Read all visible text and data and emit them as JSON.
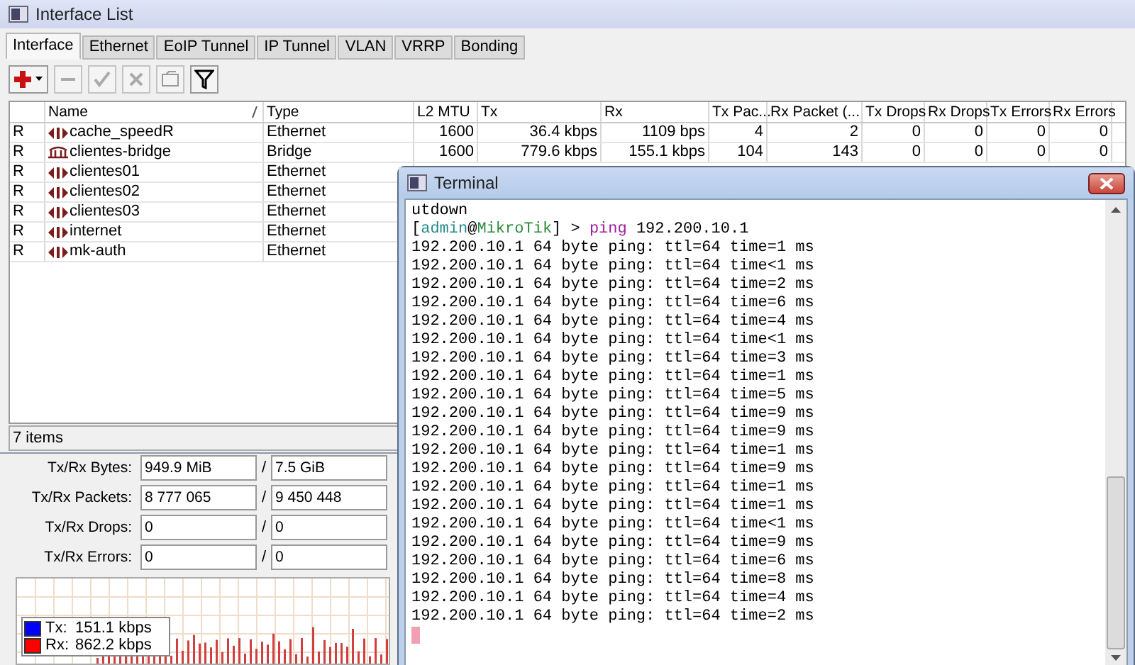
{
  "interface_window": {
    "title": "Interface List",
    "tabs": [
      {
        "label": "Interface",
        "selected": true
      },
      {
        "label": "Ethernet",
        "selected": false
      },
      {
        "label": "EoIP Tunnel",
        "selected": false
      },
      {
        "label": "IP Tunnel",
        "selected": false
      },
      {
        "label": "VLAN",
        "selected": false
      },
      {
        "label": "VRRP",
        "selected": false
      },
      {
        "label": "Bonding",
        "selected": false
      }
    ],
    "toolbar": [
      {
        "kind": "add",
        "disabled": false
      },
      {
        "kind": "remove",
        "disabled": true
      },
      {
        "kind": "enable",
        "disabled": true
      },
      {
        "kind": "disable",
        "disabled": true
      },
      {
        "kind": "comment",
        "disabled": true
      },
      {
        "kind": "filter",
        "disabled": false
      }
    ],
    "table": {
      "columns": [
        {
          "label": "Name",
          "sorted": true
        },
        {
          "label": "Type",
          "sorted": false
        },
        {
          "label": "L2 MTU",
          "sorted": false
        },
        {
          "label": "Tx",
          "sorted": false
        },
        {
          "label": "Rx",
          "sorted": false
        },
        {
          "label": "Tx Pac...",
          "sorted": false
        },
        {
          "label": "Rx Packet (...",
          "sorted": false
        },
        {
          "label": "Tx Drops",
          "sorted": false
        },
        {
          "label": "Rx Drops",
          "sorted": false
        },
        {
          "label": "Tx Errors",
          "sorted": false
        },
        {
          "label": "Rx Errors",
          "sorted": false
        }
      ],
      "rows": [
        {
          "flag": "R",
          "kind": "ethernet",
          "name": "cache_speedR",
          "type": "Ethernet",
          "values": [
            "1600",
            "36.4 kbps",
            "1109 bps",
            "4",
            "2",
            "0",
            "0",
            "0",
            "0"
          ]
        },
        {
          "flag": "R",
          "kind": "bridge",
          "name": "clientes-bridge",
          "type": "Bridge",
          "values": [
            "1600",
            "779.6 kbps",
            "155.1 kbps",
            "104",
            "143",
            "0",
            "0",
            "0",
            "0"
          ]
        },
        {
          "flag": "R",
          "kind": "ethernet",
          "name": "clientes01",
          "type": "Ethernet",
          "values": []
        },
        {
          "flag": "R",
          "kind": "ethernet",
          "name": "clientes02",
          "type": "Ethernet",
          "values": []
        },
        {
          "flag": "R",
          "kind": "ethernet",
          "name": "clientes03",
          "type": "Ethernet",
          "values": []
        },
        {
          "flag": "R",
          "kind": "ethernet",
          "name": "internet",
          "type": "Ethernet",
          "values": []
        },
        {
          "flag": "R",
          "kind": "ethernet",
          "name": "mk-auth",
          "type": "Ethernet",
          "values": []
        }
      ]
    },
    "status": "7 items"
  },
  "stats_panel": {
    "rows": [
      {
        "label": "Tx/Rx Bytes:",
        "tx": "949.9 MiB",
        "separator": "/",
        "rx": "7.5 GiB"
      },
      {
        "label": "Tx/Rx Packets:",
        "tx": "8 777 065",
        "separator": "/",
        "rx": "9 450 448"
      },
      {
        "label": "Tx/Rx Drops:",
        "tx": "0",
        "separator": "/",
        "rx": "0"
      },
      {
        "label": "Tx/Rx Errors:",
        "tx": "0",
        "separator": "/",
        "rx": "0"
      }
    ],
    "legend": [
      {
        "label": "Tx:",
        "value": "151.1 kbps",
        "color": "#0000ff"
      },
      {
        "label": "Rx:",
        "value": "862.2 kbps",
        "color": "#ff0000"
      }
    ]
  },
  "terminal": {
    "title": "Terminal",
    "lines": [
      {
        "kind": "output",
        "text": "utdown"
      },
      {
        "kind": "prompt",
        "parts": [
          {
            "kind": "plain",
            "text": "["
          },
          {
            "kind": "user",
            "text": "admin"
          },
          {
            "kind": "plain",
            "text": "@"
          },
          {
            "kind": "host",
            "text": "MikroTik"
          },
          {
            "kind": "plain",
            "text": "] > "
          },
          {
            "kind": "command",
            "text": "ping"
          },
          {
            "kind": "plain",
            "text": " 192.200.10.1"
          }
        ]
      },
      {
        "kind": "output",
        "text": "192.200.10.1 64 byte ping: ttl=64 time=1 ms"
      },
      {
        "kind": "output",
        "text": "192.200.10.1 64 byte ping: ttl=64 time<1 ms"
      },
      {
        "kind": "output",
        "text": "192.200.10.1 64 byte ping: ttl=64 time=2 ms"
      },
      {
        "kind": "output",
        "text": "192.200.10.1 64 byte ping: ttl=64 time=6 ms"
      },
      {
        "kind": "output",
        "text": "192.200.10.1 64 byte ping: ttl=64 time=4 ms"
      },
      {
        "kind": "output",
        "text": "192.200.10.1 64 byte ping: ttl=64 time<1 ms"
      },
      {
        "kind": "output",
        "text": "192.200.10.1 64 byte ping: ttl=64 time=3 ms"
      },
      {
        "kind": "output",
        "text": "192.200.10.1 64 byte ping: ttl=64 time=1 ms"
      },
      {
        "kind": "output",
        "text": "192.200.10.1 64 byte ping: ttl=64 time=5 ms"
      },
      {
        "kind": "output",
        "text": "192.200.10.1 64 byte ping: ttl=64 time=9 ms"
      },
      {
        "kind": "output",
        "text": "192.200.10.1 64 byte ping: ttl=64 time=9 ms"
      },
      {
        "kind": "output",
        "text": "192.200.10.1 64 byte ping: ttl=64 time=1 ms"
      },
      {
        "kind": "output",
        "text": "192.200.10.1 64 byte ping: ttl=64 time=9 ms"
      },
      {
        "kind": "output",
        "text": "192.200.10.1 64 byte ping: ttl=64 time=1 ms"
      },
      {
        "kind": "output",
        "text": "192.200.10.1 64 byte ping: ttl=64 time=1 ms"
      },
      {
        "kind": "output",
        "text": "192.200.10.1 64 byte ping: ttl=64 time<1 ms"
      },
      {
        "kind": "output",
        "text": "192.200.10.1 64 byte ping: ttl=64 time=9 ms"
      },
      {
        "kind": "output",
        "text": "192.200.10.1 64 byte ping: ttl=64 time=6 ms"
      },
      {
        "kind": "output",
        "text": "192.200.10.1 64 byte ping: ttl=64 time=8 ms"
      },
      {
        "kind": "output",
        "text": "192.200.10.1 64 byte ping: ttl=64 time=4 ms"
      },
      {
        "kind": "output",
        "text": "192.200.10.1 64 byte ping: ttl=64 time=2 ms"
      },
      {
        "kind": "cursor"
      }
    ]
  }
}
